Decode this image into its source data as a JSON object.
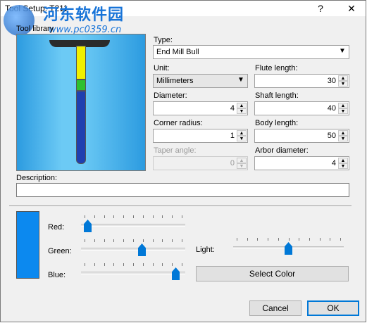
{
  "window": {
    "title": "Tool Setup: T211",
    "help_glyph": "?",
    "close_glyph": "✕"
  },
  "watermark": {
    "line1": "河东软件园",
    "line2": "www.pc0359.cn"
  },
  "library": {
    "label": "Tool library"
  },
  "fields": {
    "type": {
      "label": "Type:",
      "value": "End Mill Bull"
    },
    "unit": {
      "label": "Unit:",
      "value": "Millimeters"
    },
    "flute_length": {
      "label": "Flute length:",
      "value": "30"
    },
    "diameter": {
      "label": "Diameter:",
      "value": "4"
    },
    "shaft_length": {
      "label": "Shaft length:",
      "value": "40"
    },
    "corner_radius": {
      "label": "Corner radius:",
      "value": "1"
    },
    "body_length": {
      "label": "Body length:",
      "value": "50"
    },
    "taper_angle": {
      "label": "Taper angle:",
      "value": "0"
    },
    "arbor_diameter": {
      "label": "Arbor diameter:",
      "value": "4"
    },
    "description": {
      "label": "Description:",
      "value": ""
    }
  },
  "color": {
    "swatch": "#0c89ef",
    "red": {
      "label": "Red:",
      "level": 0.03
    },
    "green": {
      "label": "Green:",
      "level": 0.59
    },
    "blue": {
      "label": "Blue:",
      "level": 0.94
    },
    "light": {
      "label": "Light:",
      "level": 0.5
    },
    "select_label": "Select Color"
  },
  "buttons": {
    "cancel": "Cancel",
    "ok": "OK"
  }
}
